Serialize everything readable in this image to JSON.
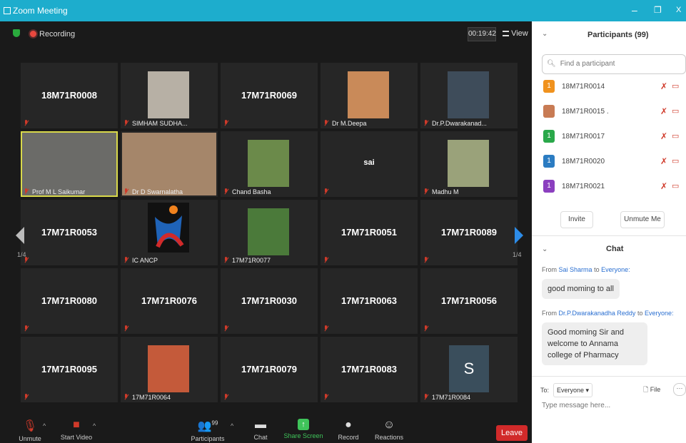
{
  "window": {
    "title": "Zoom Meeting",
    "minimize": "–",
    "restore": "❐",
    "close": "X",
    "accent": "#1dadcd"
  },
  "topbar": {
    "recording": "Recording",
    "timer": "00:19:42",
    "view": "View"
  },
  "tiles": [
    {
      "name": "18M71R0008",
      "label": "",
      "type": "name"
    },
    {
      "name": "",
      "label": "SIMHAM SUDHA...",
      "type": "photo",
      "photo_color": "#b7b0a5"
    },
    {
      "name": "17M71R0069",
      "label": "",
      "type": "name"
    },
    {
      "name": "",
      "label": "Dr M.Deepa",
      "type": "photo",
      "photo_color": "#c98a59"
    },
    {
      "name": "",
      "label": "Dr.P.Dwarakanad...",
      "type": "photo",
      "photo_color": "#3e4c5a"
    },
    {
      "name": "",
      "label": "Prof M L Saikumar",
      "type": "video",
      "photo_color": "#6b6b68",
      "active": true
    },
    {
      "name": "",
      "label": "Dr D Swarnalatha",
      "type": "video",
      "photo_color": "#a5866a"
    },
    {
      "name": "",
      "label": "Chand Basha",
      "type": "photo",
      "photo_color": "#6b8a4a"
    },
    {
      "name": "sai",
      "label": "",
      "type": "name-small"
    },
    {
      "name": "",
      "label": "Madhu M",
      "type": "photo",
      "photo_color": "#9aa27a"
    },
    {
      "name": "17M71R0053",
      "label": "",
      "type": "name"
    },
    {
      "name": "",
      "label": "IC ANCP",
      "type": "logo"
    },
    {
      "name": "",
      "label": "17M71R0077",
      "type": "photo",
      "photo_color": "#4b7a3a"
    },
    {
      "name": "17M71R0051",
      "label": "",
      "type": "name"
    },
    {
      "name": "17M71R0089",
      "label": "",
      "type": "name"
    },
    {
      "name": "17M71R0080",
      "label": "",
      "type": "name"
    },
    {
      "name": "17M71R0076",
      "label": "",
      "type": "name"
    },
    {
      "name": "17M71R0030",
      "label": "",
      "type": "name"
    },
    {
      "name": "17M71R0063",
      "label": "",
      "type": "name"
    },
    {
      "name": "17M71R0056",
      "label": "",
      "type": "name"
    },
    {
      "name": "17M71R0095",
      "label": "",
      "type": "name"
    },
    {
      "name": "",
      "label": "17M71R0064",
      "type": "photo",
      "photo_color": "#c45a3a"
    },
    {
      "name": "17M71R0079",
      "label": "",
      "type": "name"
    },
    {
      "name": "17M71R0083",
      "label": "",
      "type": "name"
    },
    {
      "name": "",
      "label": "17M71R0084",
      "type": "avatar",
      "avatar_letter": "S",
      "photo_color": "#3a4e5c"
    }
  ],
  "paging": {
    "left": "1/4",
    "right": "1/4"
  },
  "toolbar": {
    "unmute": "Unmute",
    "start_video": "Start Video",
    "participants": "Participants",
    "participants_count": "99",
    "chat": "Chat",
    "share_screen": "Share Screen",
    "record": "Record",
    "reactions": "Reactions",
    "leave": "Leave"
  },
  "participants_panel": {
    "title": "Participants (99)",
    "search_placeholder": "Find a participant",
    "items": [
      {
        "name": "18M71R0014",
        "avatar": "1",
        "color": "#f0921e"
      },
      {
        "name": "18M71R0015 .",
        "avatar": "",
        "color": "#c87b54"
      },
      {
        "name": "18M71R0017",
        "avatar": "1",
        "color": "#2aa84a"
      },
      {
        "name": "18M71R0020",
        "avatar": "1",
        "color": "#2b7cc2"
      },
      {
        "name": "18M71R0021",
        "avatar": "1",
        "color": "#8b3fbf"
      }
    ],
    "invite": "Invite",
    "unmute_me": "Unmute Me"
  },
  "chat_panel": {
    "title": "Chat",
    "messages": [
      {
        "from_prefix": "From",
        "sender": "Sai Sharma",
        "to_word": "to",
        "recipient": "Everyone:",
        "text": "good moming to all"
      },
      {
        "from_prefix": "From",
        "sender": "Dr.P.Dwarakanadha Reddy",
        "to_word": "to",
        "recipient": "Everyone:",
        "text": "Good moming Sir and welcome to Annama college of Pharmacy"
      }
    ],
    "to_label": "To:",
    "to_value": "Everyone",
    "file": "File",
    "placeholder": "Type message here..."
  }
}
